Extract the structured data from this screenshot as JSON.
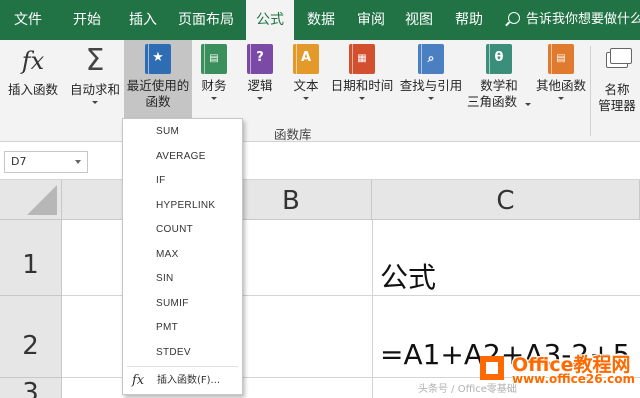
{
  "tabs": [
    "文件",
    "开始",
    "插入",
    "页面布局",
    "公式",
    "数据",
    "审阅",
    "视图",
    "帮助"
  ],
  "active_tab": "公式",
  "tell_me": "告诉我你想要做什么",
  "ribbon": {
    "insert_function": "插入函数",
    "autosum": "自动求和",
    "recent_line1": "最近使用的",
    "recent_line2": "函数",
    "financial": "财务",
    "logical": "逻辑",
    "text": "文本",
    "datetime": "日期和时间",
    "lookup": "查找与引用",
    "math_line1": "数学和",
    "math_line2": "三角函数",
    "more": "其他函数",
    "name_line1": "名称",
    "name_line2": "管理器",
    "group_label": "函数库"
  },
  "icons": {
    "fx": "fx",
    "sigma": "Σ",
    "logical": "?",
    "text": "A",
    "math": "θ"
  },
  "name_box": "D7",
  "grid": {
    "columns": [
      "B",
      "C"
    ],
    "rows": [
      "1",
      "2",
      "3"
    ],
    "c1": "公式",
    "c2": "=A1+A2+A3-2+5"
  },
  "dropdown": {
    "items": [
      "SUM",
      "AVERAGE",
      "IF",
      "HYPERLINK",
      "COUNT",
      "MAX",
      "SIN",
      "SUMIF",
      "PMT",
      "STDEV"
    ],
    "insert_label": "插入函数(F)..."
  },
  "watermark": {
    "title": "Office教程网",
    "url": "www.office26.com",
    "caption": "头条号 / Office零基础"
  },
  "colors": {
    "accent": "#217346",
    "watermark": "#ff6a00"
  }
}
